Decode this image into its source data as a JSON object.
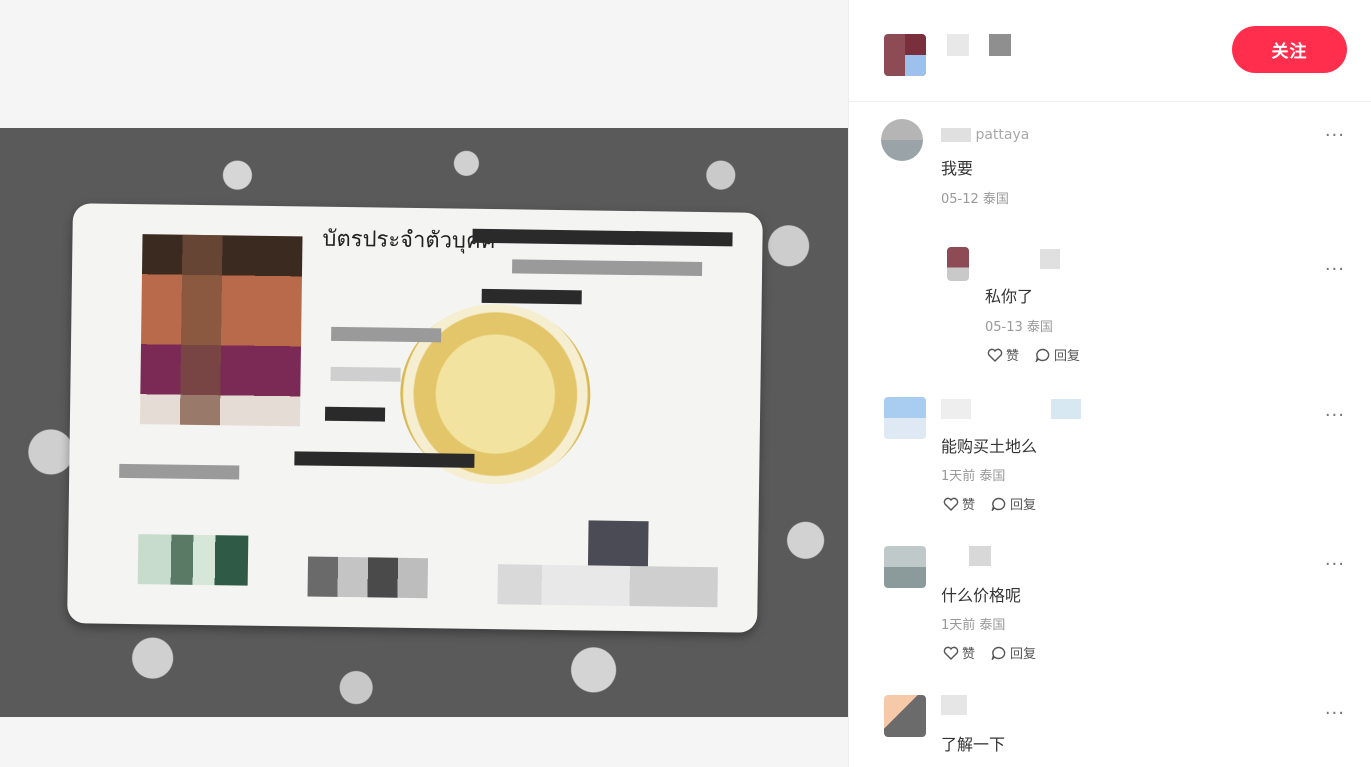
{
  "media": {
    "card_title": "บัตรประจำตัวบุคค"
  },
  "header": {
    "follow_label": "关注"
  },
  "comments": [
    {
      "name": "pattaya",
      "text": "我要",
      "meta": "05-12 泰国"
    },
    {
      "name": "",
      "text": "私你了",
      "meta": "05-13 泰国",
      "like_label": "赞",
      "reply_label": "回复"
    },
    {
      "name": "",
      "text": "能购买土地么",
      "meta": "1天前 泰国",
      "like_label": "赞",
      "reply_label": "回复"
    },
    {
      "name": "",
      "text": "什么价格呢",
      "meta": "1天前 泰国",
      "like_label": "赞",
      "reply_label": "回复"
    },
    {
      "name": "",
      "text": "了解一下"
    }
  ],
  "colors": {
    "accent": "#ff2e4d",
    "meta_text": "#999999"
  },
  "icons": [
    "heart-icon",
    "chat-bubble-icon",
    "more-dots-icon"
  ]
}
